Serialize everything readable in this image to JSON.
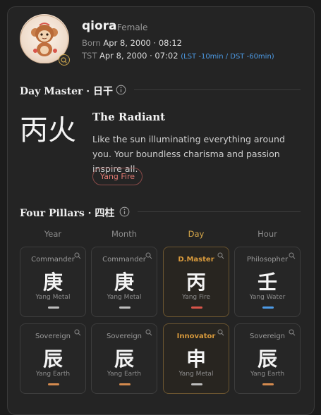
{
  "profile": {
    "name": "qiora",
    "gender": "Female",
    "born_label": "Born",
    "born_value": "Apr 8, 2000 · 08:12",
    "tst_label": "TST",
    "tst_value": "Apr 8, 2000 · 07:02",
    "tst_note": "(LST -10min / DST -60min)"
  },
  "day_master": {
    "section_title": "Day Master · 日干",
    "chars": "丙火",
    "title": "The Radiant",
    "description": "Like the sun illuminating everything around you. Your boundless charisma and passion inspire all.",
    "tag": "Yang Fire"
  },
  "four_pillars": {
    "section_title": "Four Pillars · 四柱",
    "columns": [
      "Year",
      "Month",
      "Day",
      "Hour"
    ],
    "active_column": "Day",
    "stems": [
      {
        "role": "Commander",
        "char": "庚",
        "element": "Yang Metal",
        "bar_color": "#bdbdbd"
      },
      {
        "role": "Commander",
        "char": "庚",
        "element": "Yang Metal",
        "bar_color": "#bdbdbd"
      },
      {
        "role": "D.Master",
        "char": "丙",
        "element": "Yang Fire",
        "bar_color": "#d9554a"
      },
      {
        "role": "Philosopher",
        "char": "壬",
        "element": "Yang Water",
        "bar_color": "#4d9be6"
      }
    ],
    "branches": [
      {
        "role": "Sovereign",
        "char": "辰",
        "element": "Yang Earth",
        "bar_color": "#d48a4e"
      },
      {
        "role": "Sovereign",
        "char": "辰",
        "element": "Yang Earth",
        "bar_color": "#d48a4e"
      },
      {
        "role": "Innovator",
        "char": "申",
        "element": "Yang Metal",
        "bar_color": "#bdbdbd"
      },
      {
        "role": "Sovereign",
        "char": "辰",
        "element": "Yang Earth",
        "bar_color": "#d48a4e"
      }
    ]
  },
  "colors": {
    "accent_gold": "#d8a94a",
    "fire": "#d9554a",
    "water": "#4d9be6",
    "earth": "#d48a4e",
    "metal": "#bdbdbd"
  }
}
